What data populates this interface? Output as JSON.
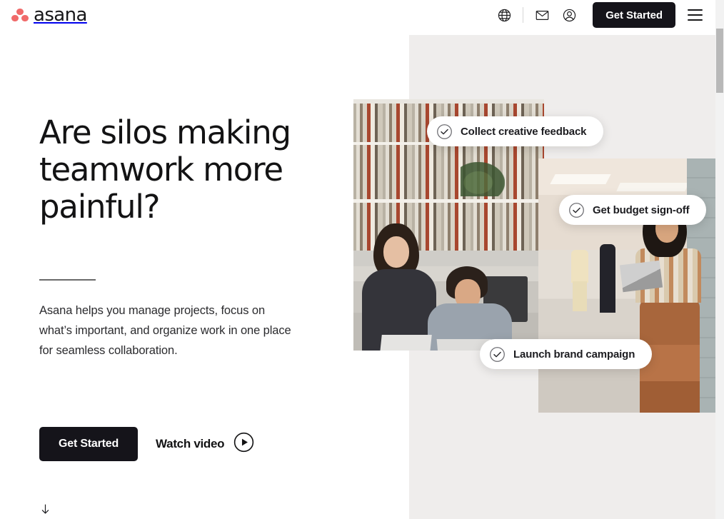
{
  "header": {
    "brand": "asana",
    "icons": [
      {
        "name": "globe-icon",
        "label": "Language"
      },
      {
        "name": "mail-icon",
        "label": "Contact"
      },
      {
        "name": "account-icon",
        "label": "Account"
      }
    ],
    "cta_label": "Get Started",
    "menu_label": "Menu"
  },
  "hero": {
    "headline": "Are silos making teamwork more painful?",
    "body": "Asana helps you manage projects, focus on what’s important, and organize work in one place for seamless collaboration.",
    "primary_cta": "Get Started",
    "secondary_cta": "Watch video"
  },
  "task_cards": [
    {
      "label": "Collect creative feedback",
      "icon": "check-circle-icon"
    },
    {
      "label": "Get budget sign-off",
      "icon": "check-circle-icon"
    },
    {
      "label": "Launch brand campaign",
      "icon": "check-circle-icon"
    }
  ],
  "scroll_cue": {
    "icon": "arrow-down-icon"
  },
  "colors": {
    "brand_coral": "#f06a6a",
    "ink": "#15141a",
    "panel_beige": "#efedec",
    "scrollbar_thumb": "#b8b8b8"
  }
}
